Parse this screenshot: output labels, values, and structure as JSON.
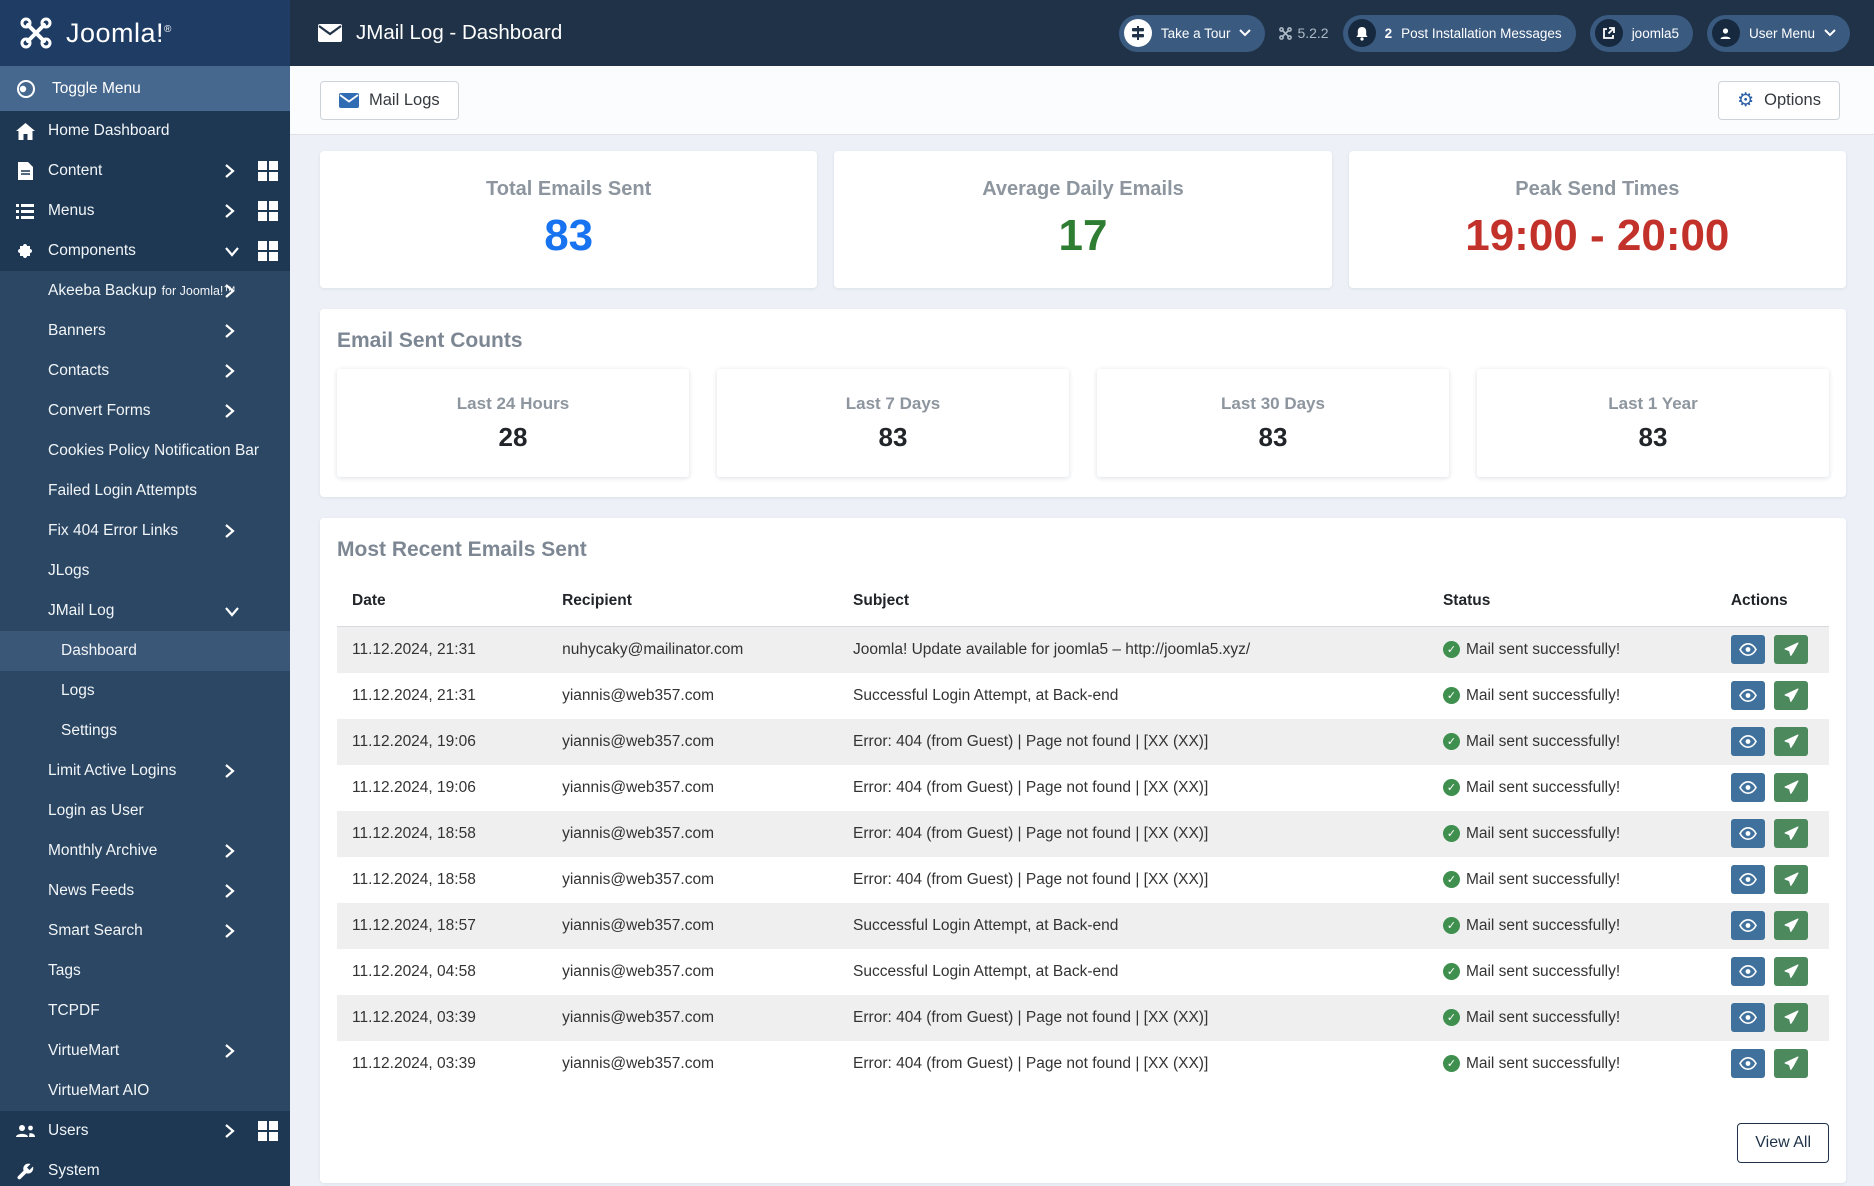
{
  "brand": {
    "logo_text": "Joomla!",
    "reg_mark": "®"
  },
  "header": {
    "title": "JMail Log - Dashboard",
    "tour_label": "Take a Tour",
    "version": "5.2.2",
    "messages_count": "2",
    "messages_label": "Post Installation Messages",
    "site_label": "joomla5",
    "user_menu_label": "User Menu"
  },
  "toolbar": {
    "mail_logs_label": "Mail Logs",
    "options_label": "Options"
  },
  "sidebar": {
    "toggle_label": "Toggle Menu",
    "items": [
      {
        "label": "Home Dashboard",
        "icon": "home",
        "level": 1
      },
      {
        "label": "Content",
        "icon": "content",
        "level": 1,
        "chevron": "right",
        "grid": true
      },
      {
        "label": "Menus",
        "icon": "menus",
        "level": 1,
        "chevron": "right",
        "grid": true
      },
      {
        "label": "Components",
        "icon": "components",
        "level": 1,
        "chevron": "down",
        "grid": true
      },
      {
        "label": "Akeeba Backup",
        "suffix": "for Joomla!™",
        "level": 2,
        "chevron": "right"
      },
      {
        "label": "Banners",
        "level": 2,
        "chevron": "right"
      },
      {
        "label": "Contacts",
        "level": 2,
        "chevron": "right"
      },
      {
        "label": "Convert Forms",
        "level": 2,
        "chevron": "right"
      },
      {
        "label": "Cookies Policy Notification Bar",
        "level": 2
      },
      {
        "label": "Failed Login Attempts",
        "level": 2
      },
      {
        "label": "Fix 404 Error Links",
        "level": 2,
        "chevron": "right"
      },
      {
        "label": "JLogs",
        "level": 2
      },
      {
        "label": "JMail Log",
        "level": 2,
        "chevron": "down"
      },
      {
        "label": "Dashboard",
        "level": 3,
        "active": true
      },
      {
        "label": "Logs",
        "level": 3
      },
      {
        "label": "Settings",
        "level": 3
      },
      {
        "label": "Limit Active Logins",
        "level": 2,
        "chevron": "right"
      },
      {
        "label": "Login as User",
        "level": 2
      },
      {
        "label": "Monthly Archive",
        "level": 2,
        "chevron": "right"
      },
      {
        "label": "News Feeds",
        "level": 2,
        "chevron": "right"
      },
      {
        "label": "Smart Search",
        "level": 2,
        "chevron": "right"
      },
      {
        "label": "Tags",
        "level": 2
      },
      {
        "label": "TCPDF",
        "level": 2
      },
      {
        "label": "VirtueMart",
        "level": 2,
        "chevron": "right"
      },
      {
        "label": "VirtueMart AIO",
        "level": 2
      },
      {
        "label": "Users",
        "icon": "users",
        "level": 1,
        "chevron": "right",
        "grid": true
      },
      {
        "label": "System",
        "icon": "system",
        "level": 1
      }
    ]
  },
  "stats": [
    {
      "label": "Total Emails Sent",
      "value": "83",
      "color": "#1873f0"
    },
    {
      "label": "Average Daily Emails",
      "value": "17",
      "color": "#2e7d32"
    },
    {
      "label": "Peak Send Times",
      "value": "19:00 - 20:00",
      "color": "#c3312b"
    }
  ],
  "email_counts": {
    "title": "Email Sent Counts",
    "cards": [
      {
        "label": "Last 24 Hours",
        "value": "28"
      },
      {
        "label": "Last 7 Days",
        "value": "83"
      },
      {
        "label": "Last 30 Days",
        "value": "83"
      },
      {
        "label": "Last 1 Year",
        "value": "83"
      }
    ]
  },
  "recent": {
    "title": "Most Recent Emails Sent",
    "columns": [
      "Date",
      "Recipient",
      "Subject",
      "Status",
      "Actions"
    ],
    "status_text": "Mail sent successfully!",
    "rows": [
      {
        "date": "11.12.2024, 21:31",
        "recipient": "nuhycaky@mailinator.com",
        "subject": "Joomla! Update available for joomla5 – http://joomla5.xyz/"
      },
      {
        "date": "11.12.2024, 21:31",
        "recipient": "yiannis@web357.com",
        "subject": "Successful Login Attempt, at Back-end"
      },
      {
        "date": "11.12.2024, 19:06",
        "recipient": "yiannis@web357.com",
        "subject": "Error: 404 (from Guest) | Page not found | [XX (XX)]"
      },
      {
        "date": "11.12.2024, 19:06",
        "recipient": "yiannis@web357.com",
        "subject": "Error: 404 (from Guest) | Page not found | [XX (XX)]"
      },
      {
        "date": "11.12.2024, 18:58",
        "recipient": "yiannis@web357.com",
        "subject": "Error: 404 (from Guest) | Page not found | [XX (XX)]"
      },
      {
        "date": "11.12.2024, 18:58",
        "recipient": "yiannis@web357.com",
        "subject": "Error: 404 (from Guest) | Page not found | [XX (XX)]"
      },
      {
        "date": "11.12.2024, 18:57",
        "recipient": "yiannis@web357.com",
        "subject": "Successful Login Attempt, at Back-end"
      },
      {
        "date": "11.12.2024, 04:58",
        "recipient": "yiannis@web357.com",
        "subject": "Successful Login Attempt, at Back-end"
      },
      {
        "date": "11.12.2024, 03:39",
        "recipient": "yiannis@web357.com",
        "subject": "Error: 404 (from Guest) | Page not found | [XX (XX)]"
      },
      {
        "date": "11.12.2024, 03:39",
        "recipient": "yiannis@web357.com",
        "subject": "Error: 404 (from Guest) | Page not found | [XX (XX)]"
      }
    ],
    "view_all_label": "View All"
  }
}
